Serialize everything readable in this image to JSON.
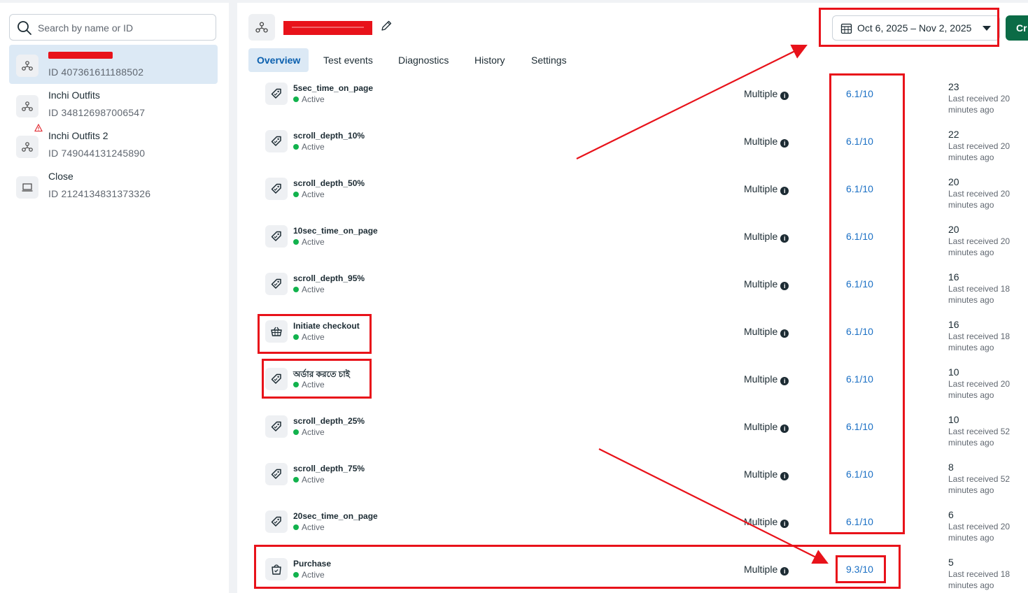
{
  "sidebar": {
    "search": {
      "placeholder": "Search by name or ID"
    },
    "datasets": [
      {
        "name": "",
        "id": "ID 407361611188502",
        "icon": "pixel-icon",
        "selected": true,
        "redacted": true
      },
      {
        "name": "Inchi Outfits",
        "id": "ID 348126987006547",
        "icon": "pixel-icon"
      },
      {
        "name": "Inchi Outfits 2",
        "id": "ID 749044131245890",
        "icon": "pixel-icon",
        "warning": true
      },
      {
        "name": "Close",
        "id": "ID 2124134831373326",
        "icon": "offline-icon"
      }
    ]
  },
  "header": {
    "title": "",
    "title_redacted": true,
    "date_range": "Oct 6, 2025 – Nov 2, 2025",
    "create_button": "Cr"
  },
  "tabs": [
    {
      "label": "Overview",
      "active": true
    },
    {
      "label": "Test events"
    },
    {
      "label": "Diagnostics"
    },
    {
      "label": "History"
    },
    {
      "label": "Settings"
    }
  ],
  "events": [
    {
      "name": "5sec_time_on_page",
      "status": "Active",
      "integration": "Multiple",
      "score": "6.1/10",
      "count": "23",
      "received": "Last received 20 minutes ago",
      "icon": "tag-icon"
    },
    {
      "name": "scroll_depth_10%",
      "status": "Active",
      "integration": "Multiple",
      "score": "6.1/10",
      "count": "22",
      "received": "Last received 20 minutes ago",
      "icon": "tag-icon"
    },
    {
      "name": "scroll_depth_50%",
      "status": "Active",
      "integration": "Multiple",
      "score": "6.1/10",
      "count": "20",
      "received": "Last received 20 minutes ago",
      "icon": "tag-icon"
    },
    {
      "name": "10sec_time_on_page",
      "status": "Active",
      "integration": "Multiple",
      "score": "6.1/10",
      "count": "20",
      "received": "Last received 20 minutes ago",
      "icon": "tag-icon"
    },
    {
      "name": "scroll_depth_95%",
      "status": "Active",
      "integration": "Multiple",
      "score": "6.1/10",
      "count": "16",
      "received": "Last received 18 minutes ago",
      "icon": "tag-icon"
    },
    {
      "name": "Initiate checkout",
      "status": "Active",
      "integration": "Multiple",
      "score": "6.1/10",
      "count": "16",
      "received": "Last received 18 minutes ago",
      "icon": "basket-icon"
    },
    {
      "name": "অর্ডার করতে চাই",
      "status": "Active",
      "integration": "Multiple",
      "score": "6.1/10",
      "count": "10",
      "received": "Last received 20 minutes ago",
      "icon": "tag-icon"
    },
    {
      "name": "scroll_depth_25%",
      "status": "Active",
      "integration": "Multiple",
      "score": "6.1/10",
      "count": "10",
      "received": "Last received 52 minutes ago",
      "icon": "tag-icon"
    },
    {
      "name": "scroll_depth_75%",
      "status": "Active",
      "integration": "Multiple",
      "score": "6.1/10",
      "count": "8",
      "received": "Last received 52 minutes ago",
      "icon": "tag-icon"
    },
    {
      "name": "20sec_time_on_page",
      "status": "Active",
      "integration": "Multiple",
      "score": "6.1/10",
      "count": "6",
      "received": "Last received 20 minutes ago",
      "icon": "tag-icon"
    },
    {
      "name": "Purchase",
      "status": "Active",
      "integration": "Multiple",
      "score": "9.3/10",
      "count": "5",
      "received": "Last received 18 minutes ago",
      "icon": "bag-icon"
    }
  ],
  "annotation_color": "#e8121a"
}
